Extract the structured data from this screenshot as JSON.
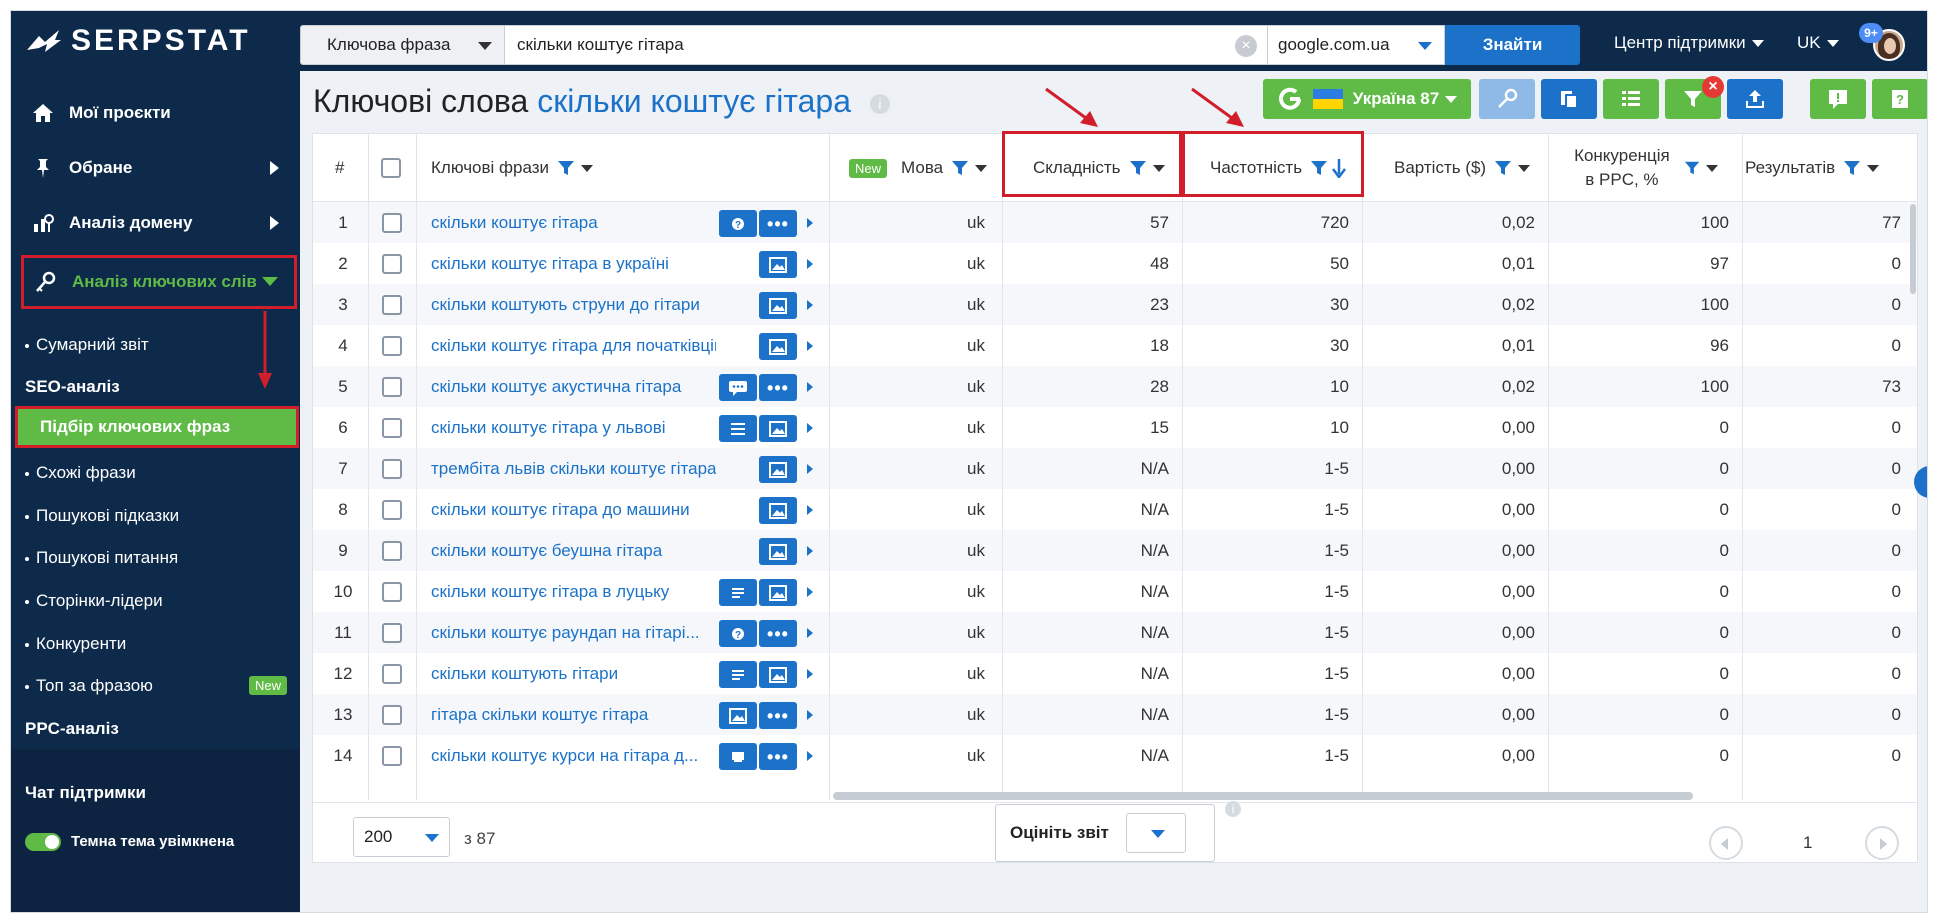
{
  "app": {
    "logo_text": "SERPSTAT"
  },
  "search": {
    "type_label": "Ключова фраза",
    "query": "скільки коштує гітара",
    "database": "google.com.ua",
    "find_label": "Знайти"
  },
  "header": {
    "support_label": "Центр підтримки",
    "lang_label": "UK",
    "notif_badge": "9+"
  },
  "sidebar": {
    "items": [
      {
        "label": "Мої проєкти",
        "icon": "home-icon"
      },
      {
        "label": "Обране",
        "icon": "pin-icon"
      },
      {
        "label": "Аналіз домену",
        "icon": "domain-analysis-icon"
      },
      {
        "label": "Аналіз ключових слів",
        "icon": "key-icon"
      }
    ],
    "summary_label": "Сумарний звіт",
    "seo_section": "SEO-аналіз",
    "seo_items": [
      "Підбір ключових фраз",
      "Схожі фрази",
      "Пошукові підказки",
      "Пошукові питання",
      "Сторінки-лідери",
      "Конкуренти",
      "Топ за фразою"
    ],
    "new_badge": "New",
    "ppc_section": "PPC-аналіз",
    "chat_label": "Чат підтримки",
    "dark_theme_label": "Темна тема увімкнена"
  },
  "page": {
    "title_prefix": "Ключові слова",
    "title_query": "скільки коштує гітара",
    "info_glyph": "i",
    "region_label": "Україна 87"
  },
  "table": {
    "columns": {
      "num": "#",
      "keyword": "Ключові фрази",
      "new_badge": "New",
      "lang": "Мова",
      "difficulty": "Складність",
      "volume": "Частотність",
      "cost": "Вартість ($)",
      "competition": "Конкуренція в PPC, %",
      "results": "Результатів"
    },
    "rows": [
      {
        "n": "1",
        "kw": "скільки коштує гітара",
        "lang": "uk",
        "diff": "57",
        "vol": "720",
        "cost": "0,02",
        "comp": "100",
        "res": "77"
      },
      {
        "n": "2",
        "kw": "скільки коштує гітара в україні",
        "lang": "uk",
        "diff": "48",
        "vol": "50",
        "cost": "0,01",
        "comp": "97",
        "res": "0"
      },
      {
        "n": "3",
        "kw": "скільки коштують струни до гітари",
        "lang": "uk",
        "diff": "23",
        "vol": "30",
        "cost": "0,02",
        "comp": "100",
        "res": "0"
      },
      {
        "n": "4",
        "kw": "скільки коштує гітара для початківців",
        "lang": "uk",
        "diff": "18",
        "vol": "30",
        "cost": "0,01",
        "comp": "96",
        "res": "0"
      },
      {
        "n": "5",
        "kw": "скільки коштує акустична гітара",
        "lang": "uk",
        "diff": "28",
        "vol": "10",
        "cost": "0,02",
        "comp": "100",
        "res": "73"
      },
      {
        "n": "6",
        "kw": "скільки коштує гітара у львові",
        "lang": "uk",
        "diff": "15",
        "vol": "10",
        "cost": "0,00",
        "comp": "0",
        "res": "0"
      },
      {
        "n": "7",
        "kw": "трембіта львів скільки коштує гітара",
        "lang": "uk",
        "diff": "N/A",
        "vol": "1-5",
        "cost": "0,00",
        "comp": "0",
        "res": "0"
      },
      {
        "n": "8",
        "kw": "скільки коштує гітара до машини",
        "lang": "uk",
        "diff": "N/A",
        "vol": "1-5",
        "cost": "0,00",
        "comp": "0",
        "res": "0"
      },
      {
        "n": "9",
        "kw": "скільки коштує беушна гітара",
        "lang": "uk",
        "diff": "N/A",
        "vol": "1-5",
        "cost": "0,00",
        "comp": "0",
        "res": "0"
      },
      {
        "n": "10",
        "kw": "скільки коштує гітара в луцьку",
        "lang": "uk",
        "diff": "N/A",
        "vol": "1-5",
        "cost": "0,00",
        "comp": "0",
        "res": "0"
      },
      {
        "n": "11",
        "kw": "скільки коштує раундап на гітарі...",
        "lang": "uk",
        "diff": "N/A",
        "vol": "1-5",
        "cost": "0,00",
        "comp": "0",
        "res": "0"
      },
      {
        "n": "12",
        "kw": "скільки коштують гітари",
        "lang": "uk",
        "diff": "N/A",
        "vol": "1-5",
        "cost": "0,00",
        "comp": "0",
        "res": "0"
      },
      {
        "n": "13",
        "kw": "гітара скільки коштує гітара",
        "lang": "uk",
        "diff": "N/A",
        "vol": "1-5",
        "cost": "0,00",
        "comp": "0",
        "res": "0"
      },
      {
        "n": "14",
        "kw": "скільки коштує курси на гітара д...",
        "lang": "uk",
        "diff": "N/A",
        "vol": "1-5",
        "cost": "0,00",
        "comp": "0",
        "res": "0"
      }
    ]
  },
  "footer": {
    "per_page": "200",
    "of_total": "з 87",
    "rate_label": "Оцініть звіт",
    "page": "1"
  },
  "colors": {
    "nav_bg": "#0e2a4a",
    "accent_blue": "#1b72c8",
    "accent_green": "#5fba46",
    "highlight_red": "#d21d2a"
  }
}
